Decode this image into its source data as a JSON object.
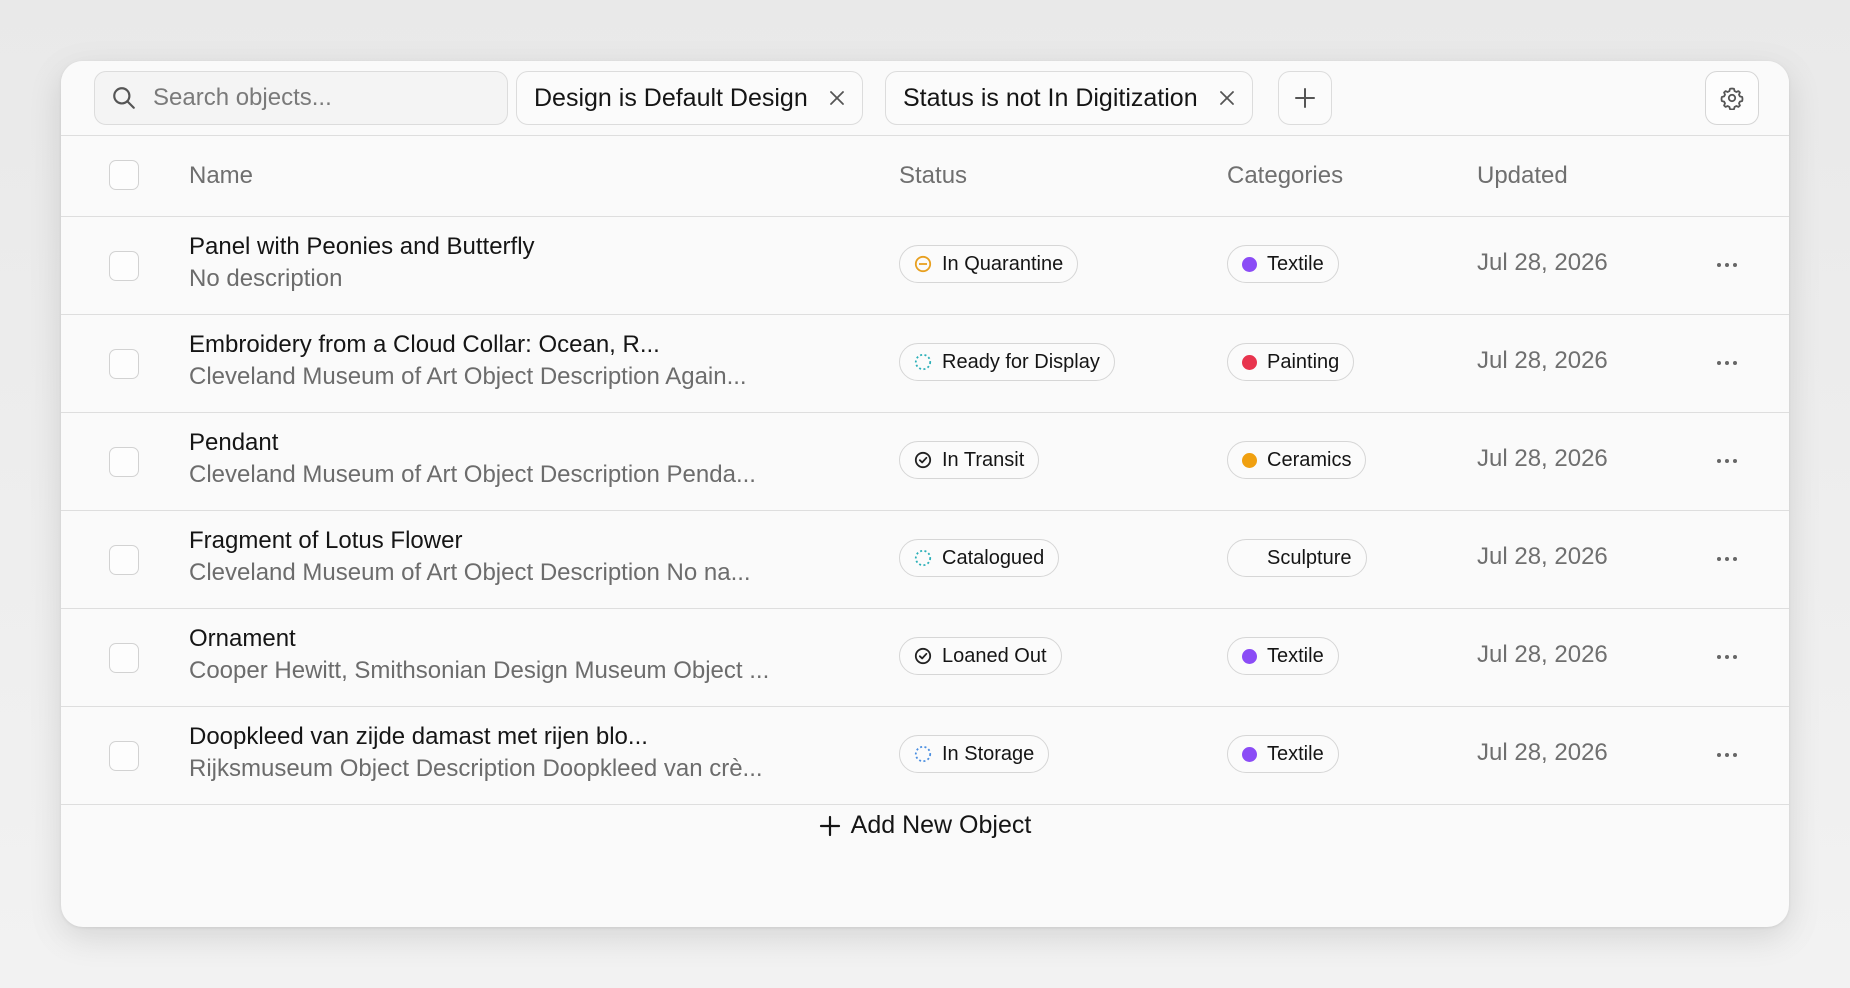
{
  "toolbar": {
    "search_placeholder": "Search objects...",
    "filters": [
      {
        "label": "Design is Default Design"
      },
      {
        "label": "Status is not In Digitization"
      }
    ]
  },
  "table": {
    "columns": {
      "name": "Name",
      "status": "Status",
      "categories": "Categories",
      "updated": "Updated"
    },
    "rows": [
      {
        "title": "Panel with Peonies and Butterfly",
        "description": "No description",
        "status": "In Quarantine",
        "status_icon": "quarantine-icon",
        "category": "Textile",
        "category_color": "#8b4cf6",
        "updated": "Jul 28, 2026"
      },
      {
        "title": "Embroidery from a Cloud Collar: Ocean, R...",
        "description": "Cleveland Museum of Art Object Description Again...",
        "status": "Ready for Display",
        "status_icon": "dotted-circle-icon",
        "category": "Painting",
        "category_color": "#e8344e",
        "updated": "Jul 28, 2026"
      },
      {
        "title": "Pendant",
        "description": "Cleveland Museum of Art Object Description Penda...",
        "status": "In Transit",
        "status_icon": "check-circle-icon",
        "category": "Ceramics",
        "category_color": "#f0a010",
        "updated": "Jul 28, 2026"
      },
      {
        "title": "Fragment of Lotus Flower",
        "description": "Cleveland Museum of Art Object Description No na...",
        "status": "Catalogued",
        "status_icon": "dotted-circle-icon",
        "category": "Sculpture",
        "category_color": "",
        "updated": "Jul 28, 2026"
      },
      {
        "title": "Ornament",
        "description": "Cooper Hewitt, Smithsonian Design Museum Object ...",
        "status": "Loaned Out",
        "status_icon": "check-circle-icon",
        "category": "Textile",
        "category_color": "#8b4cf6",
        "updated": "Jul 28, 2026"
      },
      {
        "title": "Doopkleed van zijde damast met rijen blo...",
        "description": "Rijksmuseum Object Description Doopkleed van crè...",
        "status": "In Storage",
        "status_icon": "dotted-circle-icon",
        "category": "Textile",
        "category_color": "#8b4cf6",
        "updated": "Jul 28, 2026"
      }
    ]
  },
  "footer": {
    "add_label": "Add New Object"
  },
  "colors": {
    "quarantine": "#e8a020",
    "dotted_teal": "#2bb0b8",
    "dotted_blue": "#4a8ee0"
  }
}
